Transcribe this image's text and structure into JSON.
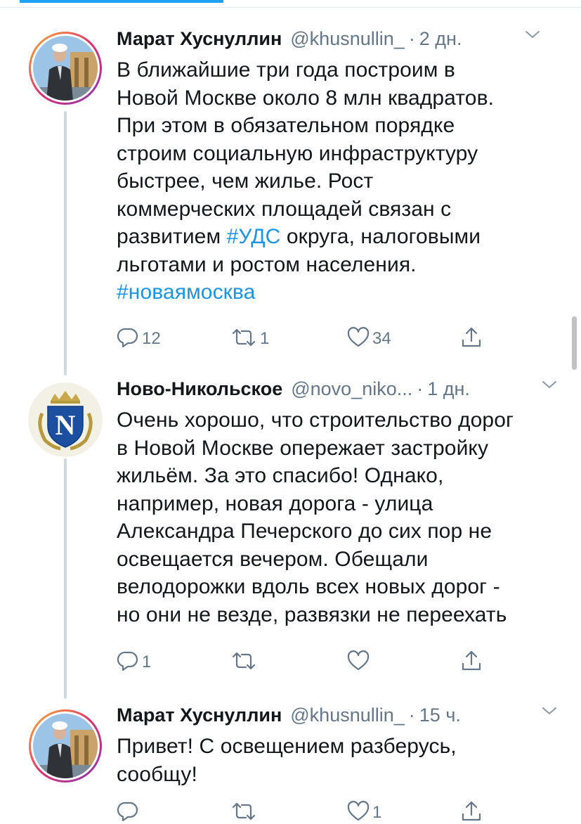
{
  "tweets": [
    {
      "name": "Марат Хуснуллин",
      "handle": "@khusnullin_",
      "separator": "·",
      "time": "2 дн.",
      "lines": [
        [
          "В ближайшие три года построим в"
        ],
        [
          "Новой Москве около 8 млн квадратов."
        ],
        [
          "При этом в обязательном порядке"
        ],
        [
          "строим социальную инфраструктуру"
        ],
        [
          "быстрее, чем жилье. Рост"
        ],
        [
          "коммерческих площадей связан с"
        ],
        [
          "развитием ",
          "#УДС",
          " округа, налоговыми"
        ],
        [
          "льготами и ростом населения."
        ],
        [
          "",
          "#новаямосква",
          ""
        ]
      ],
      "replies": "12",
      "retweets": "1",
      "likes": "34"
    },
    {
      "name": "Ново-Никольское",
      "handle": "@novo_niko...",
      "separator": "·",
      "time": "1 дн.",
      "lines": [
        [
          "Очень хорошо, что строительство дорог"
        ],
        [
          "в Новой Москве опережает застройку"
        ],
        [
          "жильём. За это спасибо! Однако,"
        ],
        [
          "например, новая дорога - улица"
        ],
        [
          "Александра Печерского до сих пор не"
        ],
        [
          "освещается вечером. Обещали"
        ],
        [
          "велодорожки вдоль всех новых дорог -"
        ],
        [
          "но они не везде, развязки не переехать"
        ]
      ],
      "replies": "1",
      "retweets": "",
      "likes": ""
    },
    {
      "name": "Марат Хуснуллин",
      "handle": "@khusnullin_",
      "separator": "·",
      "time": "15 ч.",
      "lines": [
        [
          "Привет! С освещением разберусь,"
        ],
        [
          "сообщу!"
        ]
      ],
      "replies": "",
      "retweets": "",
      "likes": "1"
    }
  ],
  "icons": {
    "reply": "reply-icon",
    "retweet": "retweet-icon",
    "like": "like-icon",
    "share": "share-icon",
    "caret": "chevron-down-icon"
  },
  "colors": {
    "accent": "#1da1f2",
    "hashtag": "#1b95e0",
    "secondary": "#657786",
    "primary": "#14171a"
  }
}
